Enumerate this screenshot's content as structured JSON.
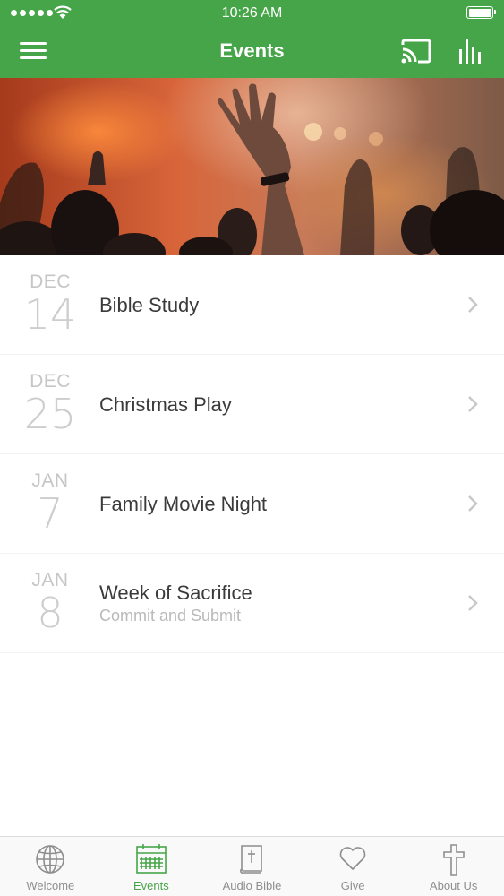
{
  "status_bar": {
    "time": "10:26 AM"
  },
  "nav": {
    "title": "Events"
  },
  "events": [
    {
      "month": "DEC",
      "day": "14",
      "title": "Bible Study",
      "subtitle": ""
    },
    {
      "month": "DEC",
      "day": "25",
      "title": "Christmas Play",
      "subtitle": ""
    },
    {
      "month": "JAN",
      "day": "7",
      "title": "Family Movie Night",
      "subtitle": ""
    },
    {
      "month": "JAN",
      "day": "8",
      "title": "Week of Sacrifice",
      "subtitle": "Commit and Submit"
    }
  ],
  "tabs": [
    {
      "label": "Welcome",
      "icon": "globe-icon"
    },
    {
      "label": "Events",
      "icon": "calendar-icon",
      "active": true
    },
    {
      "label": "Audio Bible",
      "icon": "bible-icon"
    },
    {
      "label": "Give",
      "icon": "heart-icon"
    },
    {
      "label": "About Us",
      "icon": "cross-icon"
    }
  ],
  "colors": {
    "accent": "#46a548",
    "tab_inactive": "#8e8e8e",
    "date_text": "#c6c6c6"
  }
}
